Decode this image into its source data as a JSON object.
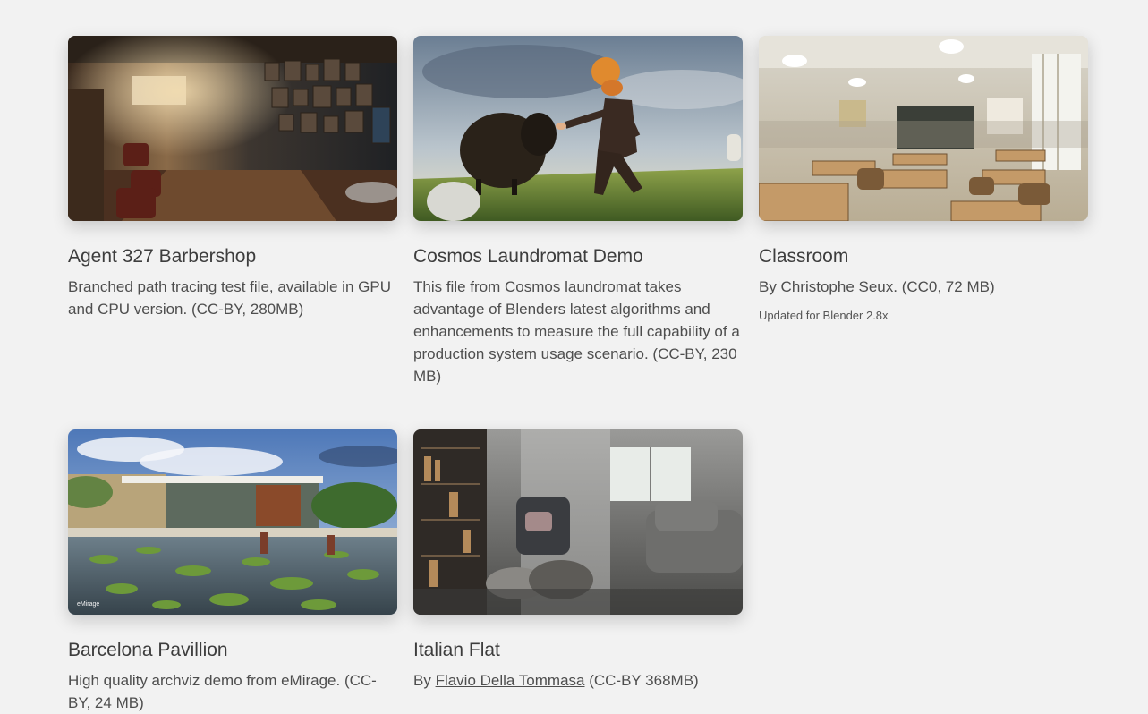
{
  "cards": [
    {
      "title": "Agent 327 Barbershop",
      "description": "Branched path tracing test file, available in GPU and CPU version. (CC-BY, 280MB)"
    },
    {
      "title": "Cosmos Laundromat Demo",
      "description": "This file from Cosmos laundromat takes advantage of Blenders latest algorithms and enhancements to measure the full capability of a production system usage scenario. (CC-BY, 230 MB)"
    },
    {
      "title": "Classroom",
      "description": "By Christophe Seux. (CC0, 72 MB)",
      "note": "Updated for Blender 2.8x"
    },
    {
      "title": "Barcelona Pavillion",
      "description": "High quality archviz demo from eMirage. (CC-BY, 24 MB)",
      "image_caption": "eMirage"
    },
    {
      "title": "Italian Flat",
      "description_prefix": "By ",
      "author_link": "Flavio Della Tommasa",
      "description_suffix": " (CC-BY 368MB)"
    }
  ],
  "colors": {
    "background": "#f2f2f2",
    "text": "#4a4a4a"
  }
}
